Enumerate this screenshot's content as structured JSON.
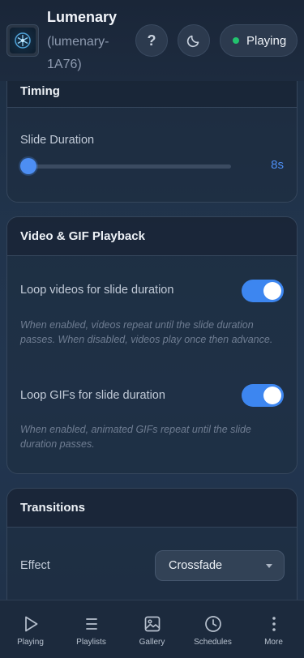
{
  "header": {
    "title": "Lumenary",
    "subtitle": "(lumenary-1A76)",
    "help_glyph": "?",
    "status": "Playing",
    "status_color": "#22c36e"
  },
  "timing": {
    "title": "Timing",
    "slide_duration_label": "Slide Duration",
    "slide_duration_value": "8s",
    "slider_fraction": 0.0
  },
  "video": {
    "title": "Video & GIF Playback",
    "loop_videos_label": "Loop videos for slide duration",
    "loop_videos_on": true,
    "loop_videos_help": "When enabled, videos repeat until the slide duration passes. When disabled, videos play once then advance.",
    "loop_gifs_label": "Loop GIFs for slide duration",
    "loop_gifs_on": true,
    "loop_gifs_help": "When enabled, animated GIFs repeat until the slide duration passes."
  },
  "transitions": {
    "title": "Transitions",
    "effect_label": "Effect",
    "effect_value": "Crossfade"
  },
  "nav": {
    "items": [
      {
        "label": "Playing",
        "icon": "play-icon"
      },
      {
        "label": "Playlists",
        "icon": "list-icon"
      },
      {
        "label": "Gallery",
        "icon": "image-icon"
      },
      {
        "label": "Schedules",
        "icon": "clock-icon"
      },
      {
        "label": "More",
        "icon": "more-vertical-icon"
      }
    ]
  },
  "colors": {
    "accent": "#4d8ef3",
    "toggle_on": "#3d86f0"
  }
}
